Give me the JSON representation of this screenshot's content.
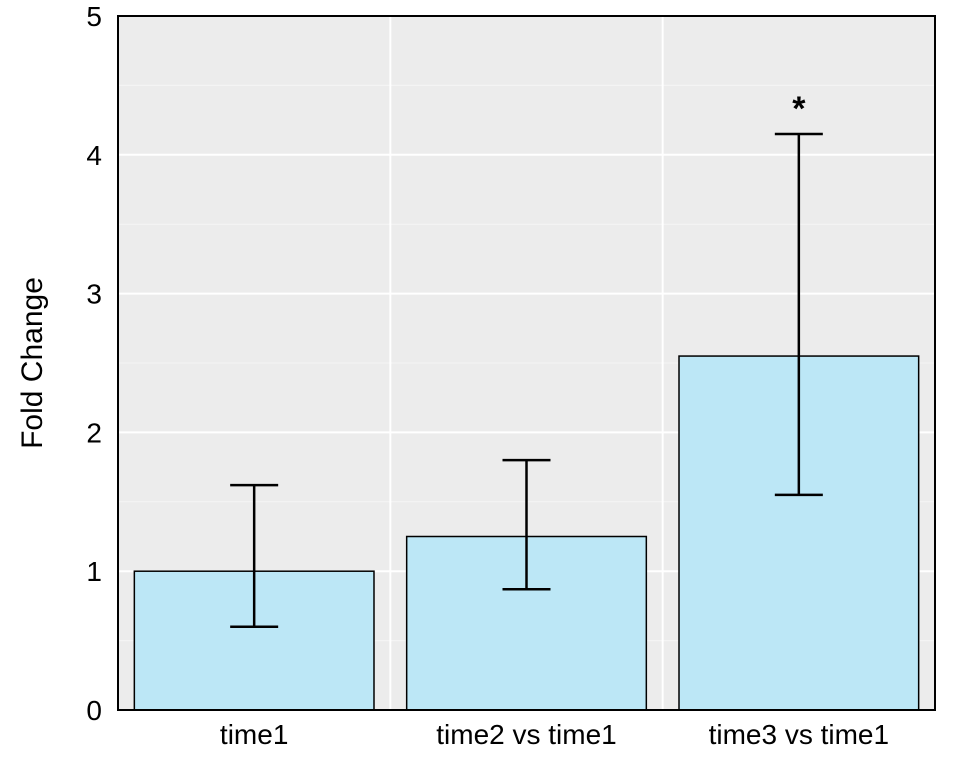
{
  "chart_data": {
    "type": "bar",
    "categories": [
      "time1",
      "time2 vs time1",
      "time3 vs time1"
    ],
    "values": [
      1.0,
      1.25,
      2.55
    ],
    "error_low": [
      0.6,
      0.87,
      1.55
    ],
    "error_high": [
      1.62,
      1.8,
      4.15
    ],
    "significance": [
      "",
      "",
      "*"
    ],
    "title": "",
    "xlabel": "",
    "ylabel": "Fold Change",
    "ylim": [
      0,
      5
    ],
    "yticks": [
      0,
      1,
      2,
      3,
      4,
      5
    ],
    "bar_fill": "#BCE7F6",
    "panel_bg": "#ECECEC"
  }
}
